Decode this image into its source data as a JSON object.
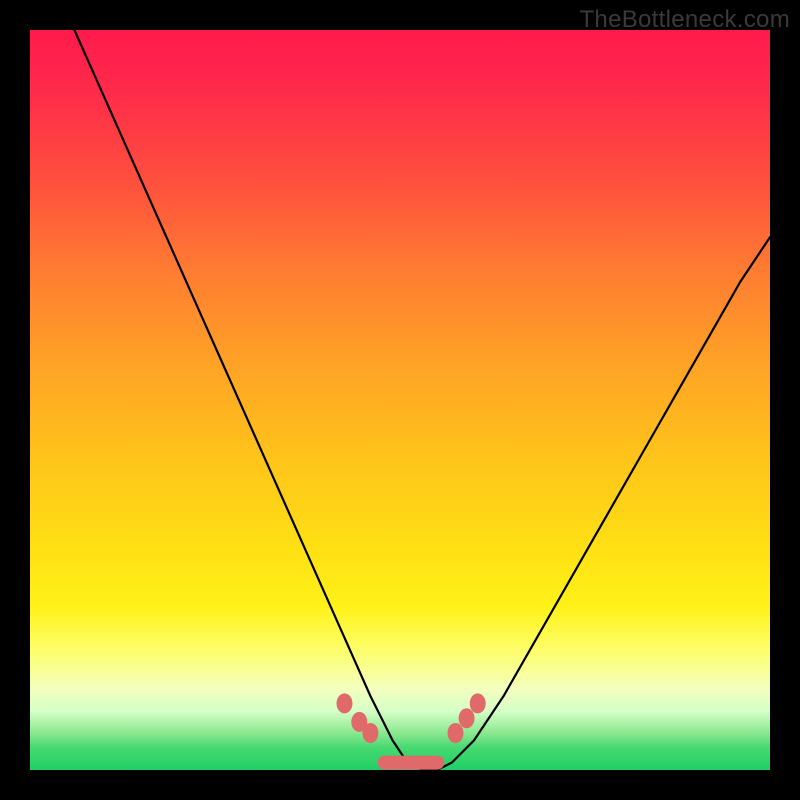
{
  "watermark": "TheBottleneck.com",
  "colors": {
    "frame": "#000000",
    "curve": "#000000",
    "marker": "#e06a6a",
    "gradient_top": "#ff1a4d",
    "gradient_bottom": "#1fcf66"
  },
  "chart_data": {
    "type": "line",
    "title": "",
    "xlabel": "",
    "ylabel": "",
    "xlim": [
      0,
      100
    ],
    "ylim": [
      0,
      100
    ],
    "series": [
      {
        "name": "bottleneck-curve",
        "x": [
          6,
          10,
          14,
          18,
          22,
          26,
          30,
          34,
          38,
          42,
          46,
          49,
          51,
          53,
          55,
          57,
          60,
          64,
          68,
          72,
          76,
          80,
          84,
          88,
          92,
          96,
          100
        ],
        "y": [
          100,
          91,
          82,
          73,
          64,
          55,
          46,
          37,
          28,
          19,
          10,
          4,
          1,
          0,
          0,
          1,
          4,
          10,
          17,
          24,
          31,
          38,
          45,
          52,
          59,
          66,
          72
        ]
      }
    ],
    "markers": {
      "name": "highlighted-points",
      "x": [
        42.5,
        44.5,
        46,
        57.5,
        59,
        60.5
      ],
      "y": [
        9,
        6.5,
        5,
        5,
        7,
        9
      ]
    },
    "flat_band": {
      "x_start": 47,
      "x_end": 56,
      "y": 1
    },
    "annotations": []
  }
}
